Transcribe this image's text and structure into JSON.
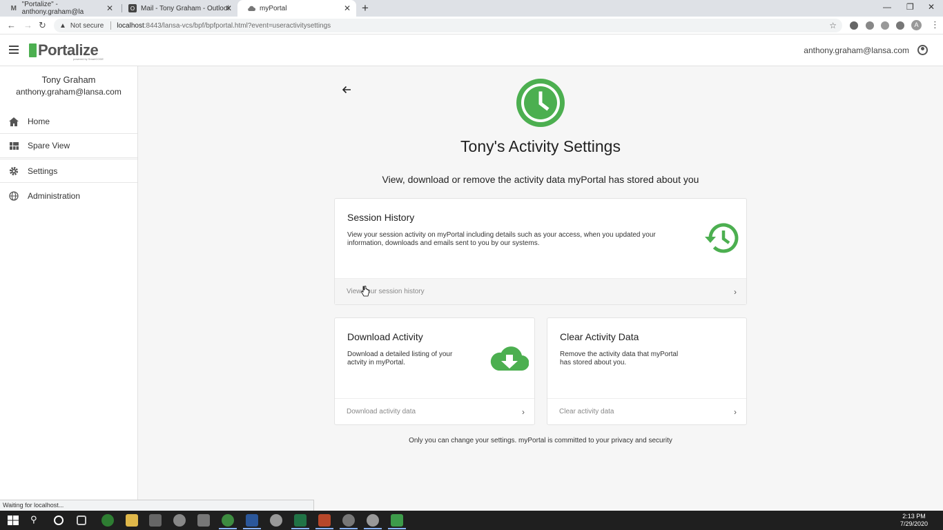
{
  "browser": {
    "tabs": [
      {
        "label": "\"Portalize\" - anthony.graham@la",
        "icon": "gmail-icon"
      },
      {
        "label": "Mail - Tony Graham - Outlook",
        "icon": "outlook-icon"
      },
      {
        "label": "myPortal",
        "icon": "cloud-icon"
      }
    ],
    "security_label": "Not secure",
    "url_host": "localhost",
    "url_path": ":8443/lansa-vcs/bpf/bpfportal.html?event=useractivitysettings",
    "profile_initial": "A"
  },
  "app": {
    "logo_text": "Portalize",
    "logo_tagline": "powered by SmartCODE",
    "header_email": "anthony.graham@lansa.com"
  },
  "sidebar": {
    "user_name": "Tony Graham",
    "user_email": "anthony.graham@lansa.com",
    "items": [
      {
        "label": "Home",
        "icon": "home-icon"
      },
      {
        "label": "Spare View",
        "icon": "grid-view-icon"
      },
      {
        "label": "Settings",
        "icon": "gear-icon"
      },
      {
        "label": "Administration",
        "icon": "globe-icon"
      }
    ]
  },
  "main": {
    "title": "Tony's Activity Settings",
    "subtitle": "View, download or remove the activity data myPortal has stored about you",
    "cards": {
      "session": {
        "title": "Session History",
        "description": "View your session activity on myPortal including details such as your access, when you updated your information, downloads and emails sent to you by our systems.",
        "action": "View your session history",
        "icon": "history-icon"
      },
      "download": {
        "title": "Download Activity",
        "description": "Download a detailed listing of your actvity in myPortal.",
        "action": "Download activity data",
        "icon": "cloud-download-icon"
      },
      "clear": {
        "title": "Clear Activity Data",
        "description": "Remove the activity data that myPortal has stored about you.",
        "action": "Clear activity data"
      }
    },
    "privacy_note": "Only you can change your settings. myPortal is committed to your privacy and security"
  },
  "status": "Waiting for localhost...",
  "taskbar": {
    "time": "2:13 PM",
    "date": "7/29/2020"
  },
  "colors": {
    "accent_green": "#4caf50",
    "taskbar": "#1f1f1f"
  }
}
